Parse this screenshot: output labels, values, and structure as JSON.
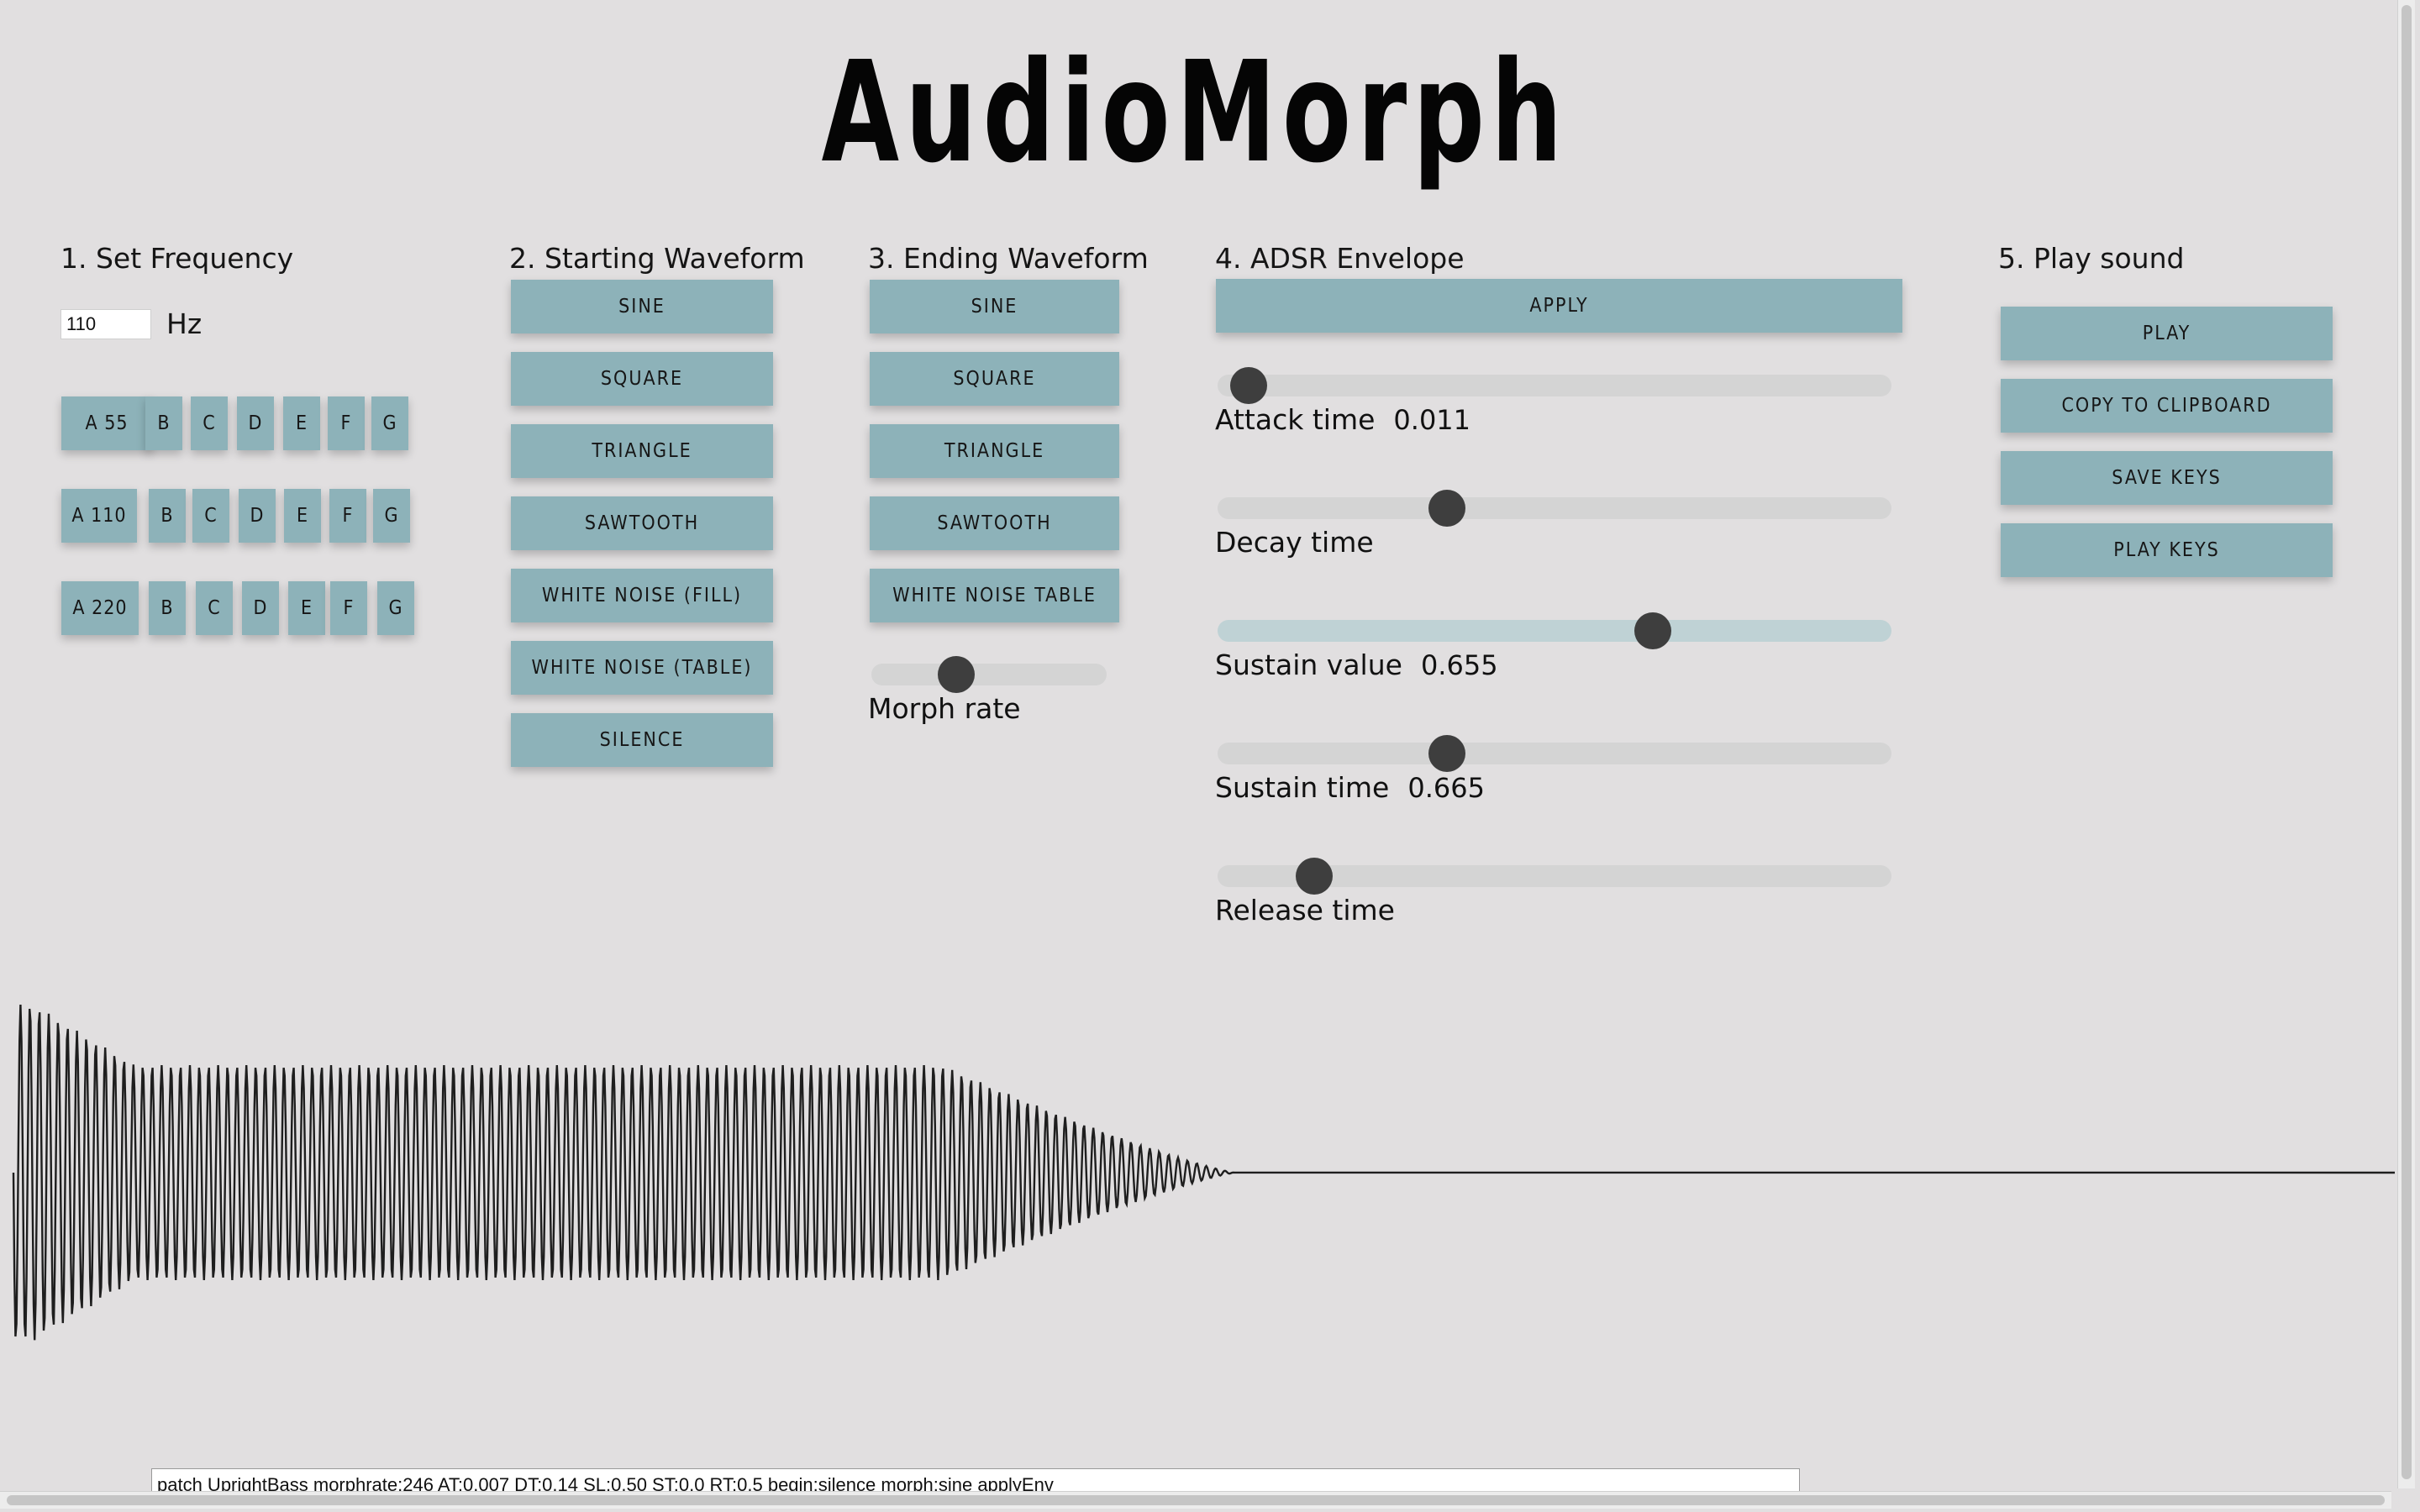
{
  "app": {
    "title": "AudioMorph"
  },
  "frequency": {
    "heading": "1. Set Frequency",
    "value": "110",
    "unit": "Hz",
    "rows": [
      [
        "A 55",
        "B",
        "C",
        "D",
        "E",
        "F",
        "G"
      ],
      [
        "A 110",
        "B",
        "C",
        "D",
        "E",
        "F",
        "G"
      ],
      [
        "A 220",
        "B",
        "C",
        "D",
        "E",
        "F",
        "G"
      ]
    ]
  },
  "starting": {
    "heading": "2. Starting Waveform",
    "buttons": [
      "SINE",
      "SQUARE",
      "TRIANGLE",
      "SAWTOOTH",
      "WHITE NOISE (FILL)",
      "WHITE NOISE (TABLE)",
      "SILENCE"
    ]
  },
  "ending": {
    "heading": "3. Ending Waveform",
    "buttons": [
      "SINE",
      "SQUARE",
      "TRIANGLE",
      "SAWTOOTH",
      "WHITE NOISE TABLE"
    ],
    "morph_label": "Morph rate",
    "morph_fraction": 0.36
  },
  "adsr": {
    "heading": "4. ADSR Envelope",
    "apply_label": "APPLY",
    "sliders": [
      {
        "label": "Attack time",
        "value": "0.011",
        "fraction": 0.046,
        "active": false
      },
      {
        "label": "Decay time",
        "value": "",
        "fraction": 0.34,
        "active": false
      },
      {
        "label": "Sustain value",
        "value": "0.655",
        "fraction": 0.646,
        "active": true
      },
      {
        "label": "Sustain time",
        "value": "0.665",
        "fraction": 0.34,
        "active": false
      },
      {
        "label": "Release time",
        "value": "",
        "fraction": 0.143,
        "active": false
      }
    ]
  },
  "play": {
    "heading": "5. Play sound",
    "buttons": [
      "PLAY",
      "COPY TO CLIPBOARD",
      "SAVE KEYS",
      "PLAY KEYS"
    ]
  },
  "patch_text": "patch UprightBass  morphrate:246 AT:0.007 DT:0.14 SL:0.50 ST:0.0 RT:0.5 begin:silence morph:sine applyEnv",
  "colors": {
    "button": "#8db2b9",
    "background": "#e1dfe0",
    "thumb": "#3e3e3e"
  }
}
